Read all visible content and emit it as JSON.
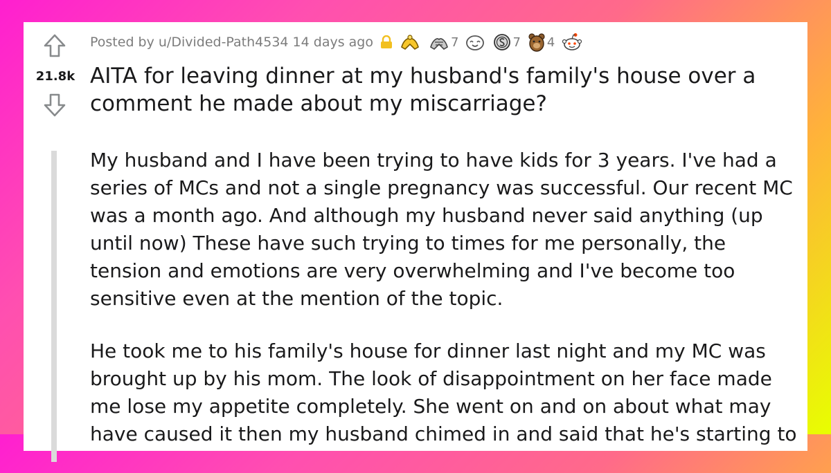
{
  "post": {
    "score": "21.8k",
    "posted_by": "Posted by u/Divided-Path4534 14 days ago",
    "awards": [
      {
        "icon": "lock-icon",
        "count": ""
      },
      {
        "icon": "gold-hands-award-icon",
        "count": ""
      },
      {
        "icon": "silver-hands-award-icon",
        "count": "7"
      },
      {
        "icon": "wholesome-face-award-icon",
        "count": ""
      },
      {
        "icon": "silver-coin-award-icon",
        "count": "7"
      },
      {
        "icon": "bear-award-icon",
        "count": "4"
      },
      {
        "icon": "snoo-award-icon",
        "count": ""
      }
    ],
    "title": "AITA for leaving dinner at my husband's family's house over a comment he made about my miscarriage?",
    "paragraphs": [
      "My husband and I have been trying to have kids for 3 years. I've had a series of MCs and not a single pregnancy was successful. Our recent MC was a month ago. And although my husband never said anything (up until now) These have such trying to times for me personally, the tension and emotions are very overwhelming and I've become too sensitive even at the mention of the topic.",
      "He took me to his family's house for dinner last night and my MC was brought up by his mom. The look of disappointment on her face made me lose my appetite completely. She went on and on about what may have caused it then my husband chimed in and said that he's starting to"
    ]
  },
  "colors": {
    "arrow": "#878a8c",
    "meta_text": "#7c7c7c",
    "title_text": "#1a1a1b",
    "thread_line": "#dadada"
  }
}
